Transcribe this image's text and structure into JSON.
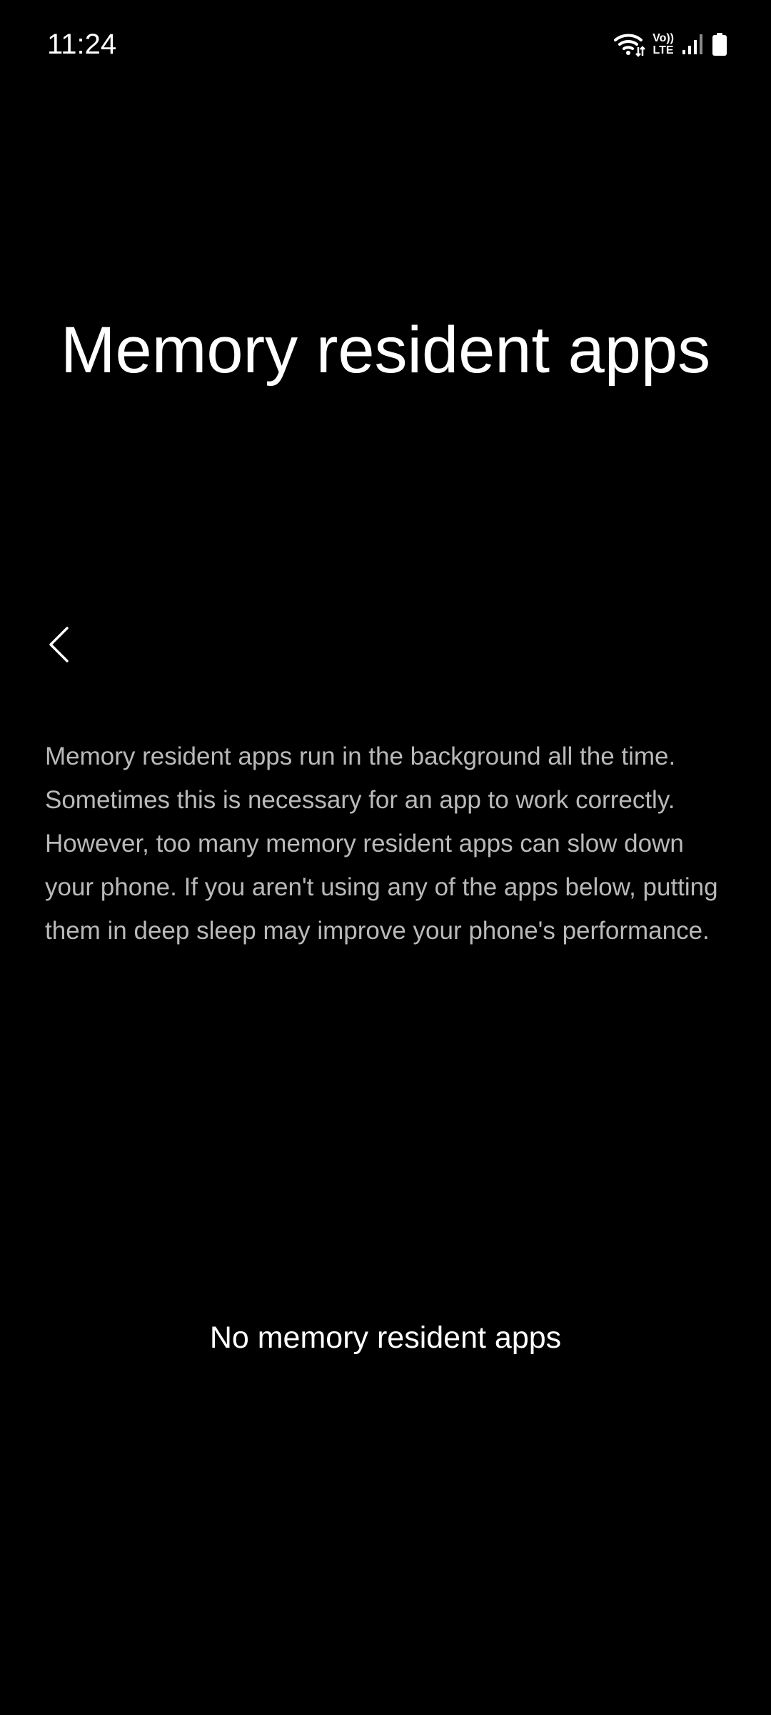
{
  "status_bar": {
    "time": "11:24",
    "volte_top": "Vo))",
    "volte_bottom": "LTE",
    "icons": [
      "wifi-icon",
      "volte-icon",
      "signal-icon",
      "battery-icon"
    ]
  },
  "header": {
    "title": "Memory resident apps",
    "back_icon": "chevron-left-icon"
  },
  "main": {
    "description": "Memory resident apps run in the background all the time. Sometimes this is necessary for an app to work correctly. However, too many memory resident apps can slow down your phone. If you aren't using any of the apps below, putting them in deep sleep may improve your phone's performance.",
    "empty_message": "No memory resident apps"
  },
  "colors": {
    "background": "#000000",
    "primary_text": "#ffffff",
    "secondary_text": "#b9b9b9"
  }
}
